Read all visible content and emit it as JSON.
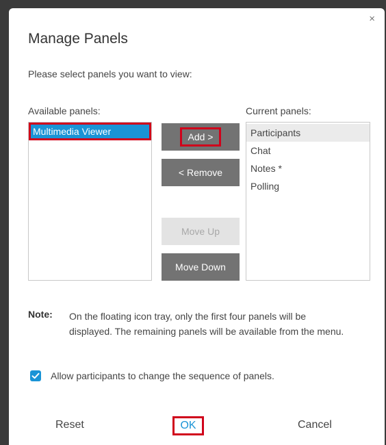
{
  "dialog": {
    "title": "Manage Panels",
    "close_glyph": "×",
    "instruction": "Please select panels you want to view:"
  },
  "available": {
    "label": "Available panels:",
    "items": [
      "Multimedia Viewer"
    ]
  },
  "current": {
    "label": "Current panels:",
    "items": [
      "Participants",
      "Chat",
      "Notes *",
      "Polling"
    ]
  },
  "buttons": {
    "add": "Add >",
    "remove": "< Remove",
    "move_up": "Move Up",
    "move_down": "Move Down"
  },
  "note": {
    "key": "Note:",
    "text": "On the floating icon tray, only the first four panels will be displayed. The remaining panels will be available from the menu."
  },
  "option": {
    "label": "Allow participants to change the sequence of panels.",
    "checked": true
  },
  "footer": {
    "reset": "Reset",
    "ok": "OK",
    "cancel": "Cancel"
  },
  "colors": {
    "accent": "#1a94d6",
    "highlight_outline": "#d0021b",
    "button_gray": "#737373"
  },
  "icons": {
    "close": "close-icon",
    "check": "checkmark-icon"
  }
}
